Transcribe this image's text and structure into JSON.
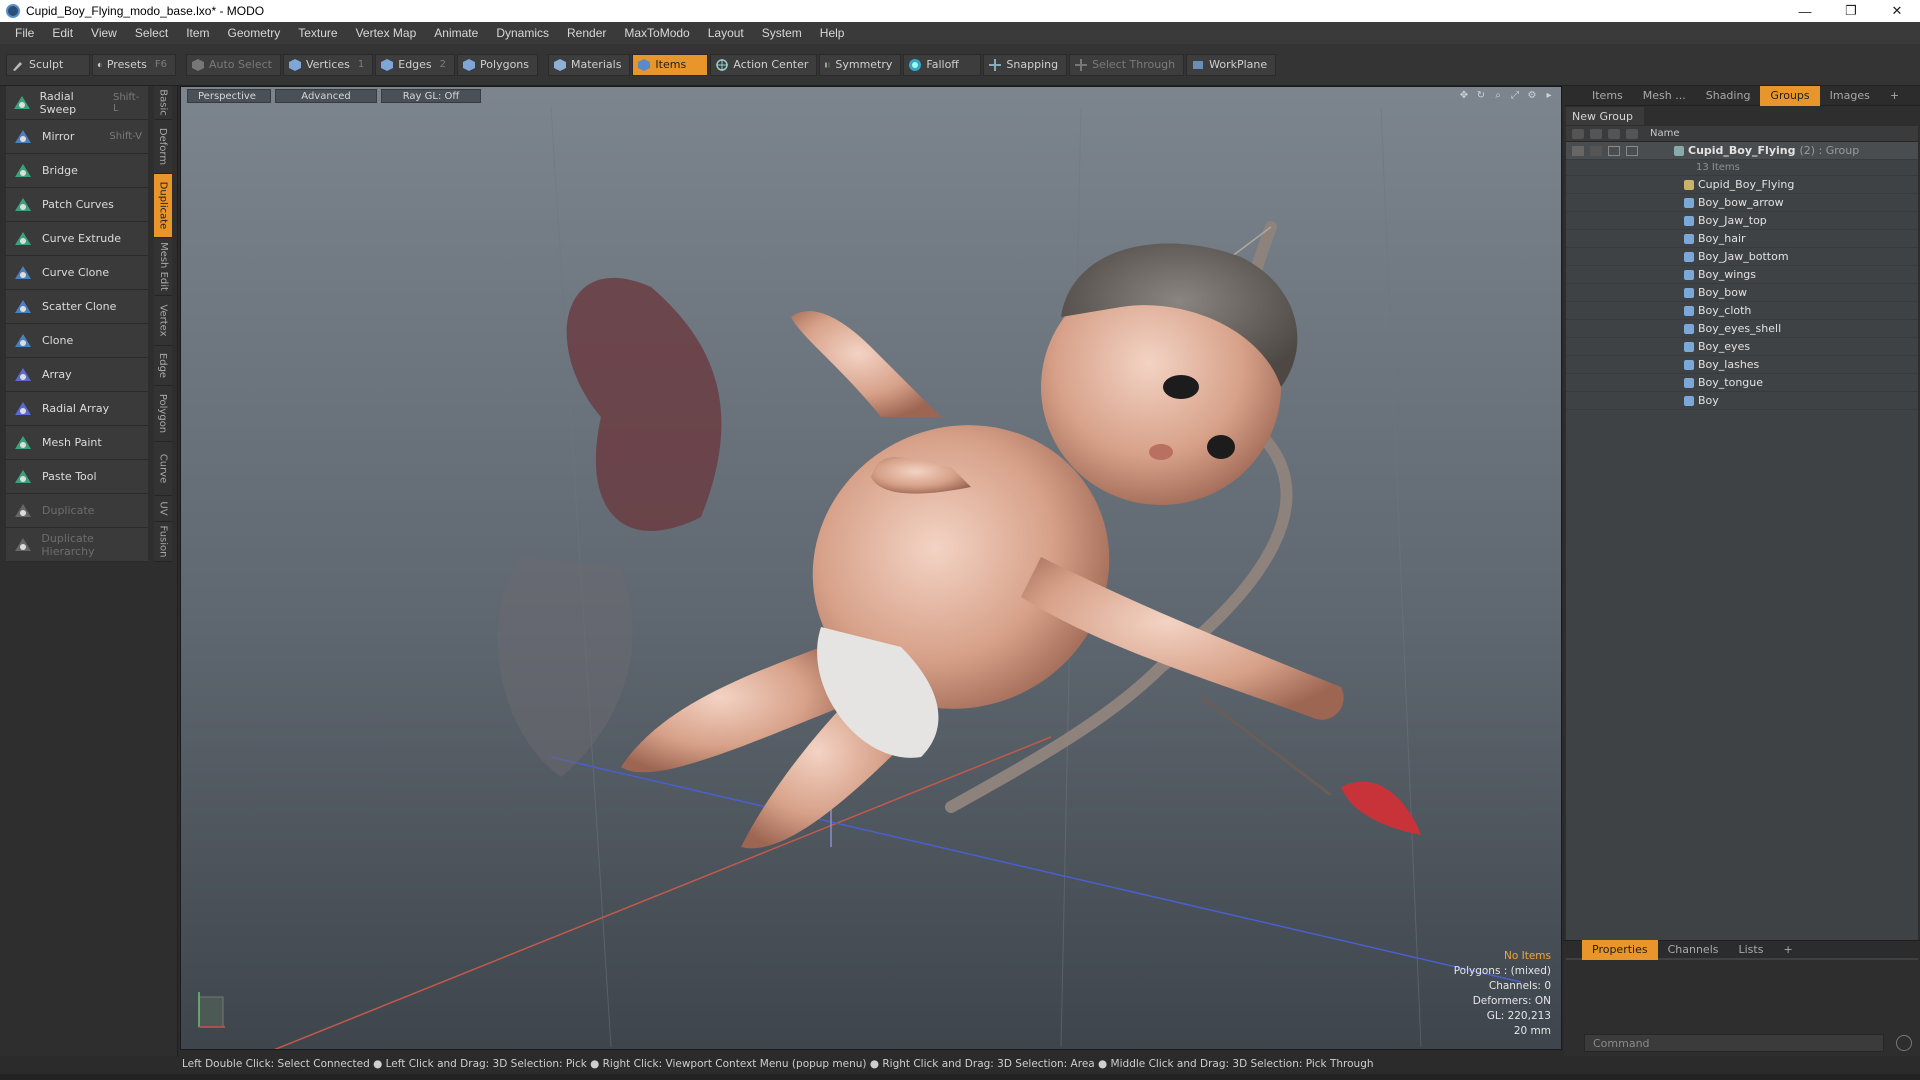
{
  "window": {
    "title": "Cupid_Boy_Flying_modo_base.lxo* - MODO",
    "controls": [
      "—",
      "❐",
      "✕"
    ]
  },
  "menu": [
    "File",
    "Edit",
    "View",
    "Select",
    "Item",
    "Geometry",
    "Texture",
    "Vertex Map",
    "Animate",
    "Dynamics",
    "Render",
    "MaxToModo",
    "Layout",
    "System",
    "Help"
  ],
  "toolbar": {
    "sculpt": "Sculpt",
    "presets": "Presets",
    "presets_key": "F6",
    "auto_select": "Auto Select",
    "vertices": "Vertices",
    "vertices_key": "1",
    "edges": "Edges",
    "edges_key": "2",
    "polygons": "Polygons",
    "materials": "Materials",
    "items": "Items",
    "action_center": "Action Center",
    "symmetry": "Symmetry",
    "falloff": "Falloff",
    "snapping": "Snapping",
    "select_through": "Select Through",
    "workplane": "WorkPlane"
  },
  "tools": [
    {
      "label": "Radial Sweep",
      "shortcut": "Shift-L",
      "color": "#3aa27a"
    },
    {
      "label": "Mirror",
      "shortcut": "Shift-V",
      "color": "#4a7fc0"
    },
    {
      "label": "Bridge",
      "shortcut": "",
      "color": "#3aa27a"
    },
    {
      "label": "Patch Curves",
      "shortcut": "",
      "color": "#3aa27a"
    },
    {
      "label": "Curve Extrude",
      "shortcut": "",
      "color": "#3aa27a"
    },
    {
      "label": "Curve Clone",
      "shortcut": "",
      "color": "#4a7fc0"
    },
    {
      "label": "Scatter Clone",
      "shortcut": "",
      "color": "#4a7fc0"
    },
    {
      "label": "Clone",
      "shortcut": "",
      "color": "#4a7fc0"
    },
    {
      "label": "Array",
      "shortcut": "",
      "color": "#5a6ad0"
    },
    {
      "label": "Radial Array",
      "shortcut": "",
      "color": "#5a6ad0"
    },
    {
      "label": "Mesh Paint",
      "shortcut": "",
      "color": "#3aa27a"
    },
    {
      "label": "Paste Tool",
      "shortcut": "",
      "color": "#3aa27a"
    },
    {
      "label": "Duplicate",
      "shortcut": "",
      "color": "#666666"
    },
    {
      "label": "Duplicate Hierarchy",
      "shortcut": "",
      "color": "#666666"
    }
  ],
  "vtabs": [
    "Basic",
    "Deform",
    "Duplicate",
    "Mesh Edit",
    "Vertex",
    "Edge",
    "Polygon",
    "Curve",
    "UV",
    "Fusion"
  ],
  "viewport": {
    "perspective": "Perspective",
    "advanced": "Advanced",
    "raygl": "Ray GL: Off",
    "info": {
      "no_items": "No Items",
      "polygons": "Polygons : (mixed)",
      "channels": "Channels: 0",
      "deformers": "Deformers: ON",
      "gl": "GL: 220,213",
      "scale": "20 mm"
    }
  },
  "right_tabs": [
    "Items",
    "Mesh ...",
    "Shading",
    "Groups",
    "Images"
  ],
  "new_group": "New Group",
  "list_header": "Name",
  "group": {
    "name": "Cupid_Boy_Flying",
    "suffix": "(2) : Group",
    "count": "13 Items"
  },
  "items": [
    "Cupid_Boy_Flying",
    "Boy_bow_arrow",
    "Boy_Jaw_top",
    "Boy_hair",
    "Boy_Jaw_bottom",
    "Boy_wings",
    "Boy_bow",
    "Boy_cloth",
    "Boy_eyes_shell",
    "Boy_eyes",
    "Boy_lashes",
    "Boy_tongue",
    "Boy"
  ],
  "bottom_tabs": [
    "Properties",
    "Channels",
    "Lists"
  ],
  "command_placeholder": "Command",
  "status": "Left Double Click: Select Connected ● Left Click and Drag: 3D Selection: Pick ● Right Click: Viewport Context Menu (popup menu) ● Right Click and Drag: 3D Selection: Area ● Middle Click and Drag: 3D Selection: Pick Through"
}
